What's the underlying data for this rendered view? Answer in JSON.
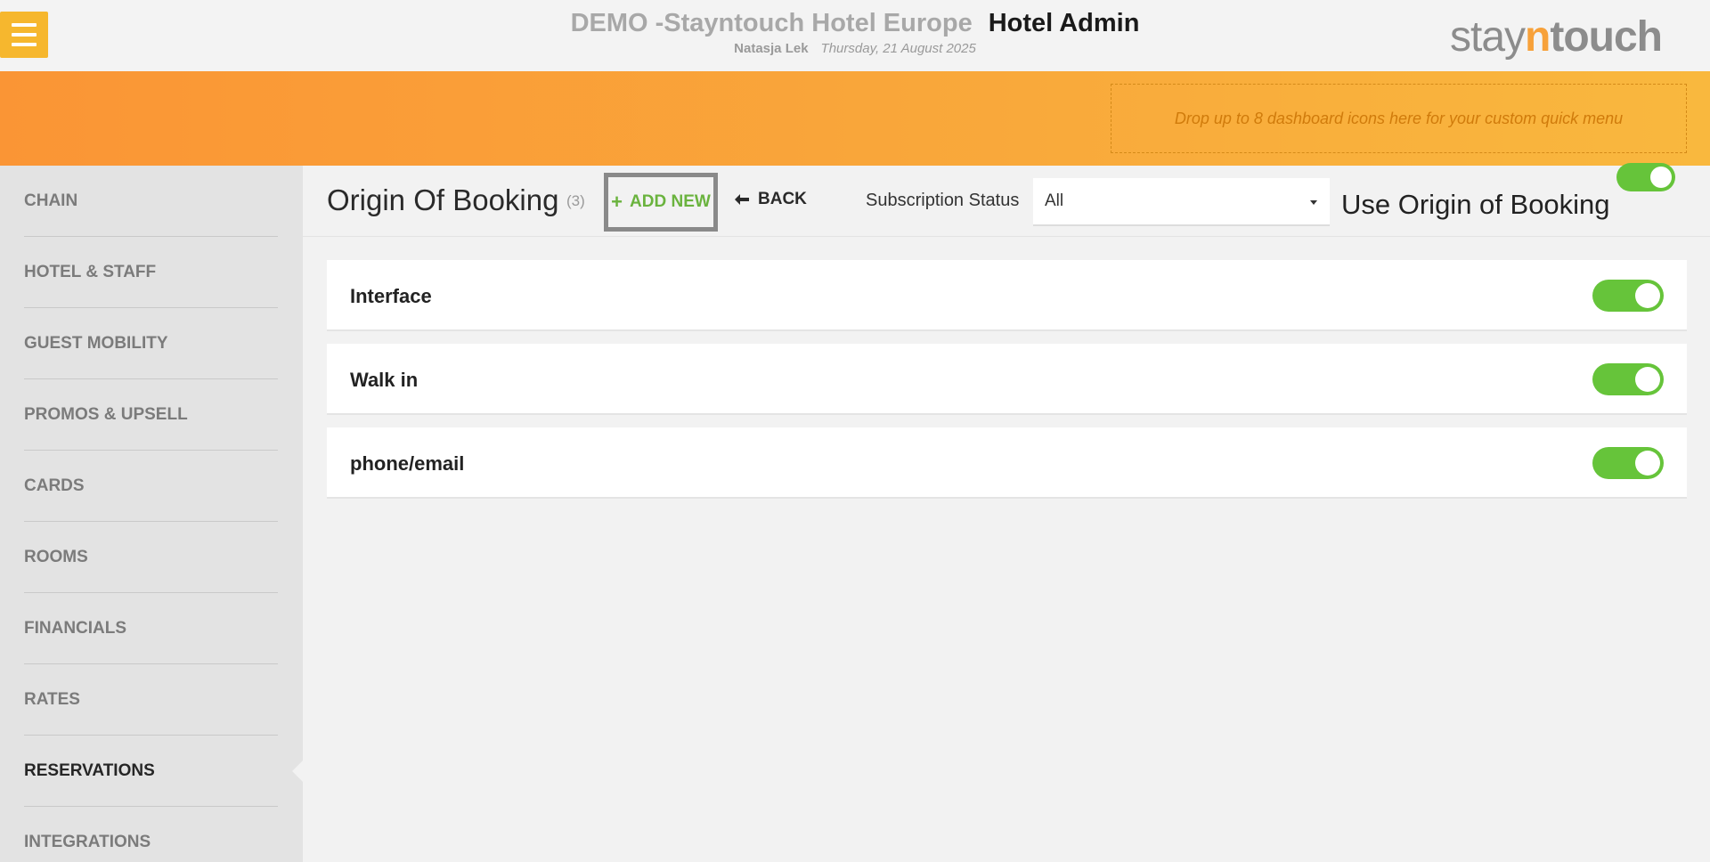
{
  "header": {
    "hotel_name": "DEMO -Stayntouch Hotel Europe",
    "admin_title": "Hotel Admin",
    "user_name": "Natasja Lek",
    "date": "Thursday, 21 August 2025",
    "logo": {
      "prefix": "stay",
      "accent": "n",
      "suffix": "touch"
    }
  },
  "quick_menu": {
    "placeholder": "Drop up to 8 dashboard icons here for your custom quick menu"
  },
  "sidebar": {
    "items": [
      {
        "label": "CHAIN",
        "active": false
      },
      {
        "label": "HOTEL & STAFF",
        "active": false
      },
      {
        "label": "GUEST MOBILITY",
        "active": false
      },
      {
        "label": "PROMOS & UPSELL",
        "active": false
      },
      {
        "label": "CARDS",
        "active": false
      },
      {
        "label": "ROOMS",
        "active": false
      },
      {
        "label": "FINANCIALS",
        "active": false
      },
      {
        "label": "RATES",
        "active": false
      },
      {
        "label": "RESERVATIONS",
        "active": true
      },
      {
        "label": "INTEGRATIONS",
        "active": false
      }
    ]
  },
  "main": {
    "title": "Origin Of Booking",
    "count": "(3)",
    "add_new_label": "ADD NEW",
    "back_label": "BACK",
    "subscription_label": "Subscription Status",
    "subscription_value": "All",
    "use_origin_label": "Use Origin of Booking",
    "use_origin_enabled": true,
    "rows": [
      {
        "label": "Interface",
        "enabled": true
      },
      {
        "label": "Walk in",
        "enabled": true
      },
      {
        "label": "phone/email",
        "enabled": true
      }
    ]
  },
  "colors": {
    "accent_orange": "#f9a93b",
    "toggle_on": "#66c43a",
    "add_new_green": "#6ab33e"
  },
  "icons": {
    "menu": "hamburger-menu-icon",
    "add": "plus-icon",
    "back": "arrow-left-icon",
    "dropdown": "caret-down-icon"
  }
}
